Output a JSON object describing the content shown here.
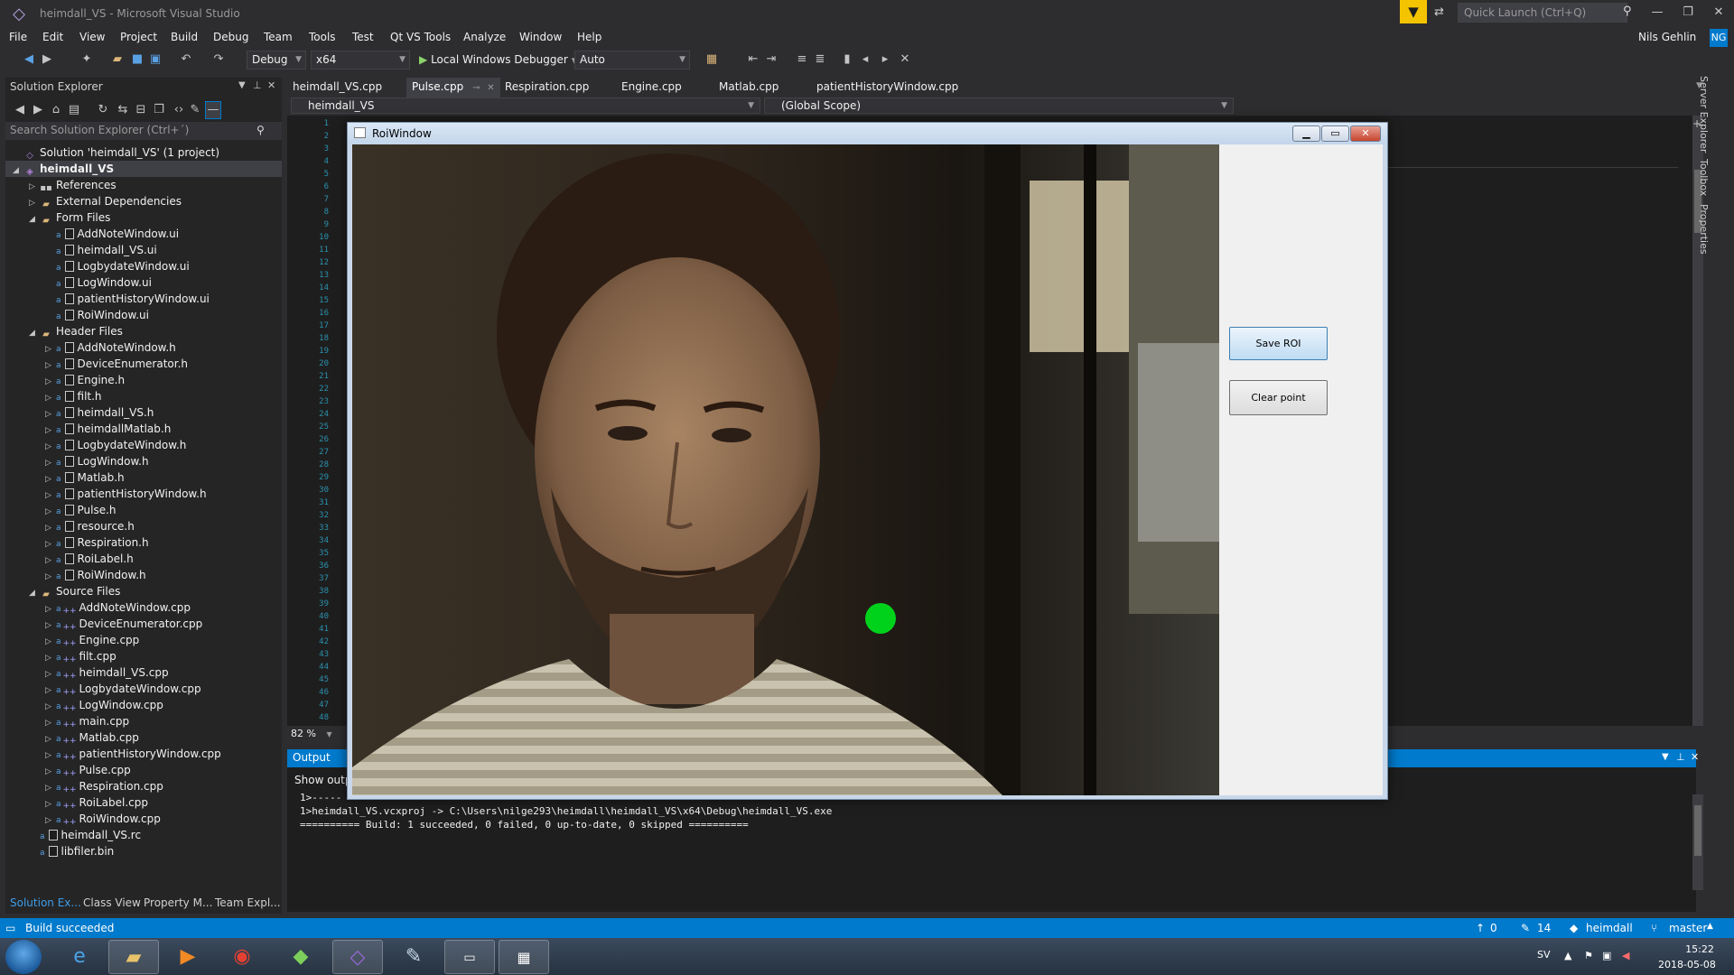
{
  "window": {
    "title": "heimdall_VS - Microsoft Visual Studio",
    "quick_launch_placeholder": "Quick Launch (Ctrl+Q)",
    "user": "Nils Gehlin",
    "user_initials": "NG"
  },
  "menu": [
    "File",
    "Edit",
    "View",
    "Project",
    "Build",
    "Debug",
    "Team",
    "Tools",
    "Test",
    "Qt VS Tools",
    "Analyze",
    "Window",
    "Help"
  ],
  "toolbar": {
    "configuration": "Debug",
    "platform": "x64",
    "debugger": "Local Windows Debugger",
    "debugger_mode": "Auto"
  },
  "solution_explorer": {
    "title": "Solution Explorer",
    "search_placeholder": "Search Solution Explorer (Ctrl+´)",
    "solution": "Solution 'heimdall_VS' (1 project)",
    "project": "heimdall_VS",
    "references": "References",
    "external_dependencies": "External Dependencies",
    "form_files_label": "Form Files",
    "form_files": [
      "AddNoteWindow.ui",
      "heimdall_VS.ui",
      "LogbydateWindow.ui",
      "LogWindow.ui",
      "patientHistoryWindow.ui",
      "RoiWindow.ui"
    ],
    "header_files_label": "Header Files",
    "header_files": [
      "AddNoteWindow.h",
      "DeviceEnumerator.h",
      "Engine.h",
      "filt.h",
      "heimdall_VS.h",
      "heimdallMatlab.h",
      "LogbydateWindow.h",
      "LogWindow.h",
      "Matlab.h",
      "patientHistoryWindow.h",
      "Pulse.h",
      "resource.h",
      "Respiration.h",
      "RoiLabel.h",
      "RoiWindow.h"
    ],
    "source_files_label": "Source Files",
    "source_files": [
      "AddNoteWindow.cpp",
      "DeviceEnumerator.cpp",
      "Engine.cpp",
      "filt.cpp",
      "heimdall_VS.cpp",
      "LogbydateWindow.cpp",
      "LogWindow.cpp",
      "main.cpp",
      "Matlab.cpp",
      "patientHistoryWindow.cpp",
      "Pulse.cpp",
      "Respiration.cpp",
      "RoiLabel.cpp",
      "RoiWindow.cpp"
    ],
    "extra_files": [
      "heimdall_VS.rc",
      "libfiler.bin"
    ],
    "bottom_tabs": [
      "Solution Ex...",
      "Class View",
      "Property M...",
      "Team Expl..."
    ]
  },
  "editor": {
    "tabs": [
      "heimdall_VS.cpp",
      "Pulse.cpp",
      "Respiration.cpp",
      "Engine.cpp",
      "Matlab.cpp",
      "patientHistoryWindow.cpp"
    ],
    "active_tab": "Pulse.cpp",
    "nav_project": "heimdall_VS",
    "nav_scope": "(Global Scope)",
    "line_count": 48,
    "zoom": "82 %",
    "side_tabs": [
      "Server Explorer",
      "Toolbox",
      "Properties"
    ]
  },
  "output": {
    "title": "Output",
    "show_output_label": "Show outp",
    "lines": [
      "1>-----",
      "1>heimdall_VS.vcxproj -> C:\\Users\\nilge293\\heimdall\\heimdall_VS\\x64\\Debug\\heimdall_VS.exe",
      "========== Build: 1 succeeded, 0 failed, 0 up-to-date, 0 skipped =========="
    ]
  },
  "roi_window": {
    "title": "RoiWindow",
    "save_roi_label": "Save ROI",
    "clear_point_label": "Clear point",
    "marker_color": "#00d21c"
  },
  "statusbar": {
    "text": "Build succeeded",
    "up_count": "0",
    "edit_count": "14",
    "repo": "heimdall",
    "branch": "master"
  },
  "taskbar": {
    "language": "SV",
    "time": "15:22",
    "date": "2018-05-08"
  },
  "colors": {
    "accent": "#007acc",
    "notification": "#f5c400"
  }
}
